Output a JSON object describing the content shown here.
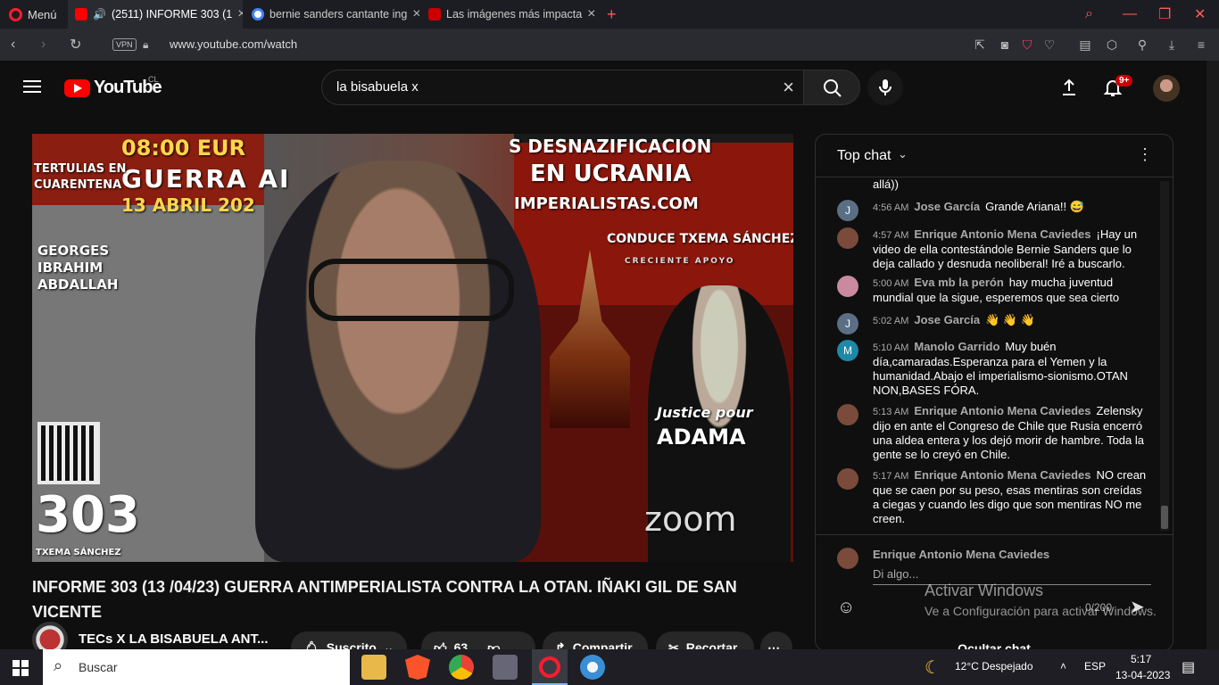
{
  "browser": {
    "menu_label": "Menú",
    "tabs": [
      {
        "title": "(2511) INFORME 303 (1",
        "favicon": "youtube-icon",
        "active": true
      },
      {
        "title": "bernie sanders cantante ing",
        "favicon": "google-icon",
        "active": false
      },
      {
        "title": "Las imágenes más impacta",
        "favicon": "cnn-icon",
        "active": false
      }
    ],
    "url": "www.youtube.com/watch",
    "vpn_label": "VPN"
  },
  "youtube": {
    "logo_text": "YouTube",
    "country": "CL",
    "search_value": "la bisabuela x",
    "notifications_badge": "9+"
  },
  "video": {
    "overlay": {
      "time": "08:00 EUR",
      "war": "GUERRA AI",
      "date": "13 ABRIL 202",
      "desnaz": "S DESNAZIFICACION",
      "ucrania": "EN UCRANIA",
      "site": "IMPERIALISTAS.COM",
      "conduce": "CONDUCE TXEMA SÁNCHEZ",
      "apoyo": "CRECIENTE APOYO",
      "name1": "GEORGES",
      "name2": "IBRAHIM",
      "name3": "ABDALLAH",
      "number": "303",
      "host": "TXEMA SÁNCHEZ",
      "zoom": "zoom",
      "tertulias1": "TERTULIAS EN",
      "tertulias2": "CUARENTENA",
      "justice1": "Justice pour",
      "justice2": "ADAMA"
    },
    "title": "INFORME 303 (13 /04/23) GUERRA ANTIMPERIALISTA CONTRA LA OTAN. IÑAKI GIL DE SAN VICENTE",
    "channel_name": "TECs X LA BISABUELA ANT...",
    "subscribe_label": "Suscrito",
    "likes": "63",
    "share_label": "Compartir",
    "clip_label": "Recortar"
  },
  "chat": {
    "header": "Top chat",
    "partial_top": "allá))",
    "messages": [
      {
        "time": "4:56 AM",
        "author": "Jose García",
        "text": "Grande Ariana!! 😅",
        "avatar": "J",
        "avatar_color": "#5b6f84"
      },
      {
        "time": "4:57 AM",
        "author": "Enrique Antonio Mena Caviedes",
        "text": "¡Hay un video de ella contestándole Bernie Sanders que lo deja callado y desnuda neoliberal! Iré a buscarlo.",
        "avatar": "",
        "avatar_color": "#7a4a3a"
      },
      {
        "time": "5:00 AM",
        "author": "Eva mb la perón",
        "text": "hay mucha juventud mundial que la sigue, esperemos que sea cierto",
        "avatar": "",
        "avatar_color": "#c98aa0"
      },
      {
        "time": "5:02 AM",
        "author": "Jose García",
        "text": "👋 👋 👋",
        "avatar": "J",
        "avatar_color": "#5b6f84"
      },
      {
        "time": "5:10 AM",
        "author": "Manolo Garrido",
        "text": "Muy buén día,camaradas.Esperanza para el Yemen y la humanidad.Abajo el imperialismo-sionismo.OTAN NON,BASES FÓRA.",
        "avatar": "M",
        "avatar_color": "#1e88a8"
      },
      {
        "time": "5:13 AM",
        "author": "Enrique Antonio Mena Caviedes",
        "text": "Zelensky dijo en ante el Congreso de Chile que Rusia encerró una aldea entera y los dejó morir de hambre. Toda la gente se lo creyó en Chile.",
        "avatar": "",
        "avatar_color": "#7a4a3a"
      },
      {
        "time": "5:17 AM",
        "author": "Enrique Antonio Mena Caviedes",
        "text": "NO crean que se caen por su peso, esas mentiras son creídas a ciegas y cuando les digo que son mentiras NO me creen.",
        "avatar": "",
        "avatar_color": "#7a4a3a"
      }
    ],
    "compose_author": "Enrique Antonio Mena Caviedes",
    "compose_placeholder": "Di algo...",
    "char_counter": "0/200",
    "hide_label": "Ocultar chat"
  },
  "watermark": {
    "line1": "Activar Windows",
    "line2": "Ve a Configuración para activar Windows."
  },
  "taskbar": {
    "search_placeholder": "Buscar",
    "weather": "12°C  Despejado",
    "language": "ESP",
    "time": "5:17",
    "date": "13-04-2023"
  }
}
